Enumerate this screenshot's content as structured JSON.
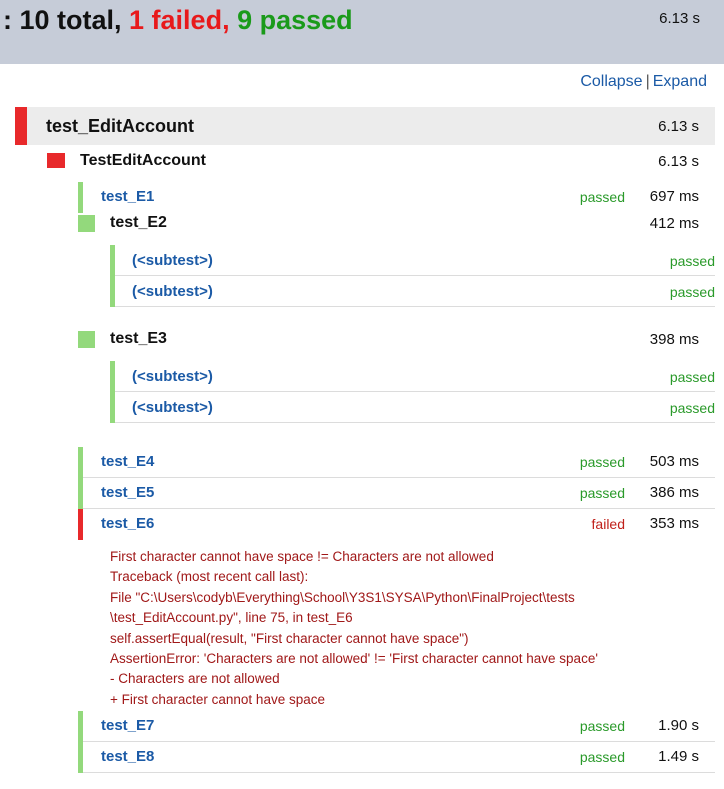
{
  "header": {
    "prefix": ": 10 total, ",
    "failed": "1 failed,",
    "passed": "9 passed",
    "total_time": "6.13 s"
  },
  "links": {
    "collapse": "Collapse",
    "sep": "|",
    "expand": "Expand"
  },
  "module": {
    "name": "test_EditAccount",
    "time": "6.13 s",
    "status_color": "#e8292b"
  },
  "class": {
    "name": "TestEditAccount",
    "time": "6.13 s",
    "status_color": "#e8292b"
  },
  "tests": {
    "e1": {
      "name": "test_E1",
      "status": "passed",
      "time": "697 ms"
    },
    "e2": {
      "name": "test_E2",
      "time": "412 ms",
      "subtests": [
        {
          "name": "(<subtest>)",
          "status": "passed"
        },
        {
          "name": "(<subtest>)",
          "status": "passed"
        }
      ]
    },
    "e3": {
      "name": "test_E3",
      "time": "398 ms",
      "subtests": [
        {
          "name": "(<subtest>)",
          "status": "passed"
        },
        {
          "name": "(<subtest>)",
          "status": "passed"
        }
      ]
    },
    "e4": {
      "name": "test_E4",
      "status": "passed",
      "time": "503 ms"
    },
    "e5": {
      "name": "test_E5",
      "status": "passed",
      "time": "386 ms"
    },
    "e6": {
      "name": "test_E6",
      "status": "failed",
      "time": "353 ms",
      "traceback": [
        "First character cannot have space != Characters are not allowed",
        "Traceback (most recent call last):",
        "File \"C:\\Users\\codyb\\Everything\\School\\Y3S1\\SYSA\\Python\\FinalProject\\tests",
        "\\test_EditAccount.py\", line 75, in test_E6",
        "self.assertEqual(result, \"First character cannot have space\")",
        "AssertionError: 'Characters are not allowed' != 'First character cannot have space'",
        "- Characters are not allowed",
        "+ First character cannot have space"
      ]
    },
    "e7": {
      "name": "test_E7",
      "status": "passed",
      "time": "1.90 s"
    },
    "e8": {
      "name": "test_E8",
      "status": "passed",
      "time": "1.49 s"
    }
  },
  "colors": {
    "passed": "#93d97c",
    "failed": "#e8292b",
    "link": "#1b5aa6"
  }
}
